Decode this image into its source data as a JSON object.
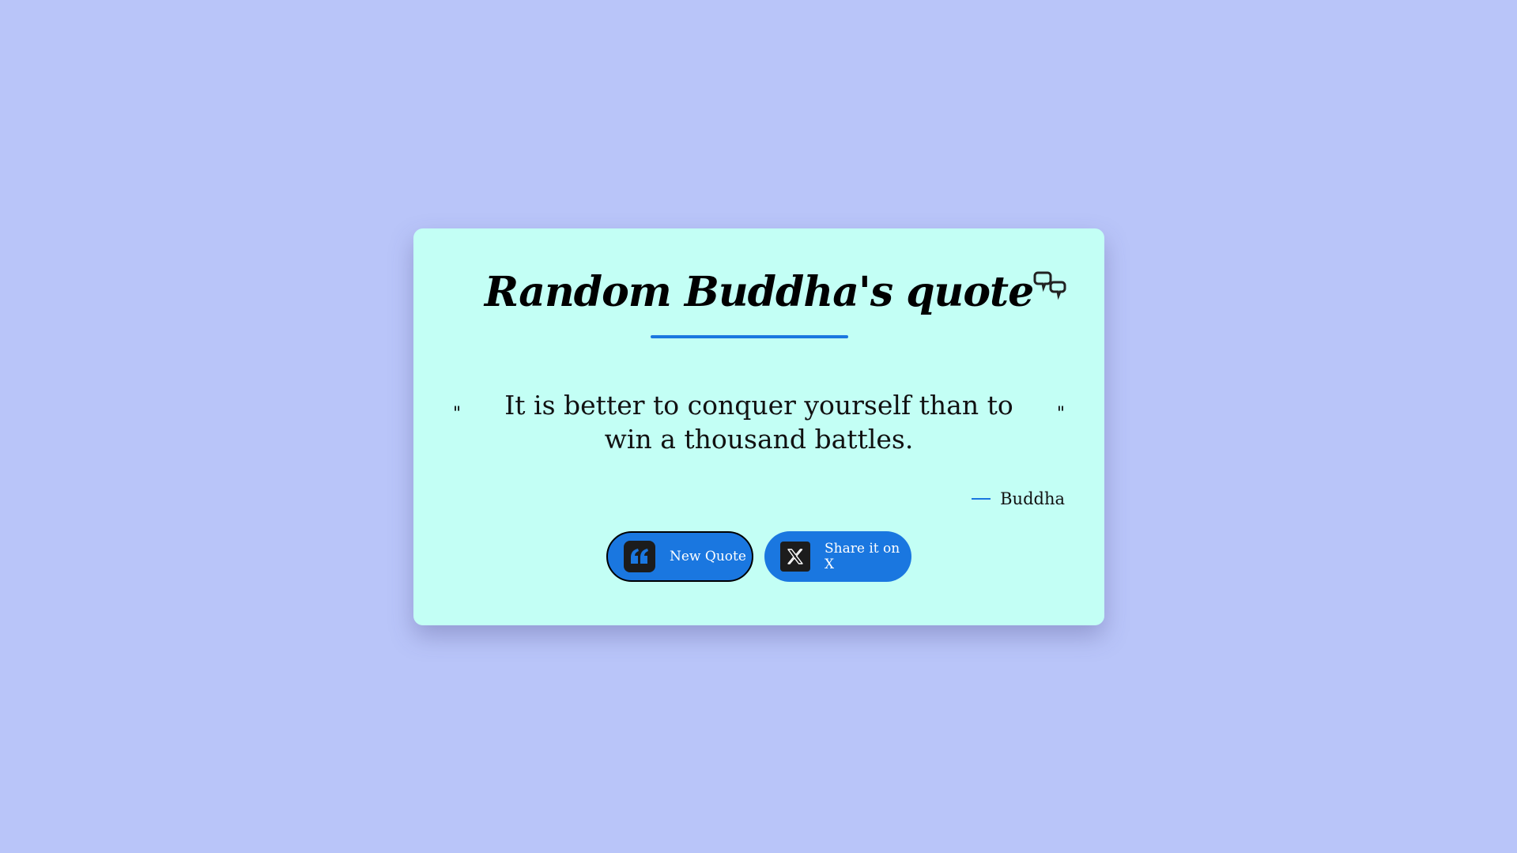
{
  "page": {
    "background_color": "#b9c5f9",
    "card_color": "#c3fff5",
    "accent_color": "#1a77e0"
  },
  "header": {
    "title": "Random Buddha's quote",
    "title_icon": "speech-bubbles-icon"
  },
  "quote": {
    "open_mark": "\"",
    "text": "It is better to conquer yourself than to win a thousand battles.",
    "close_mark": "\"",
    "author": "Buddha"
  },
  "actions": {
    "new_quote_label": "New Quote",
    "new_quote_icon": "quote-icon",
    "share_label": "Share it on X",
    "share_icon": "x-logo-icon"
  }
}
